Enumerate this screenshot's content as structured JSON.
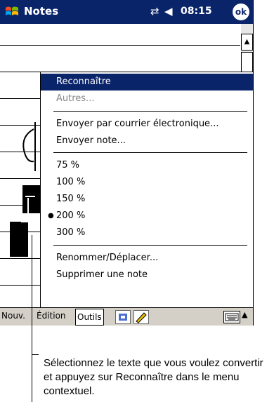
{
  "titlebar": {
    "app_title": "Notes",
    "time": "08:15",
    "ok_label": "ok",
    "icons": [
      "windows-flag-icon",
      "connectivity-icon",
      "volume-icon"
    ]
  },
  "menu": {
    "items": [
      {
        "label": "Reconnaître",
        "state": "selected"
      },
      {
        "label": "Autres...",
        "state": "disabled"
      },
      {
        "label": "Envoyer par courrier électronique...",
        "state": "normal"
      },
      {
        "label": "Envoyer note...",
        "state": "normal"
      },
      {
        "label": "75 %",
        "state": "normal"
      },
      {
        "label": "100 %",
        "state": "normal"
      },
      {
        "label": "150 %",
        "state": "normal"
      },
      {
        "label": "200 %",
        "state": "checked"
      },
      {
        "label": "300 %",
        "state": "normal"
      },
      {
        "label": "Renommer/Déplacer...",
        "state": "normal"
      },
      {
        "label": "Supprimer une note",
        "state": "normal"
      }
    ]
  },
  "cmdbar": {
    "new_label": "Nouv.",
    "edit_label": "Édition",
    "tools_label": "Outils",
    "icons": [
      "recording-icon",
      "pen-icon",
      "keyboard-icon",
      "arrow-up-icon"
    ]
  },
  "callout": {
    "text": "Sélectionnez le texte que vous voulez convertir  et appuyez sur Reconnaître dans le menu contextuel."
  },
  "colors": {
    "titlebar_bg": "#0a246a",
    "selection_bg": "#0a246a",
    "cmdbar_bg": "#d4d0c8"
  }
}
